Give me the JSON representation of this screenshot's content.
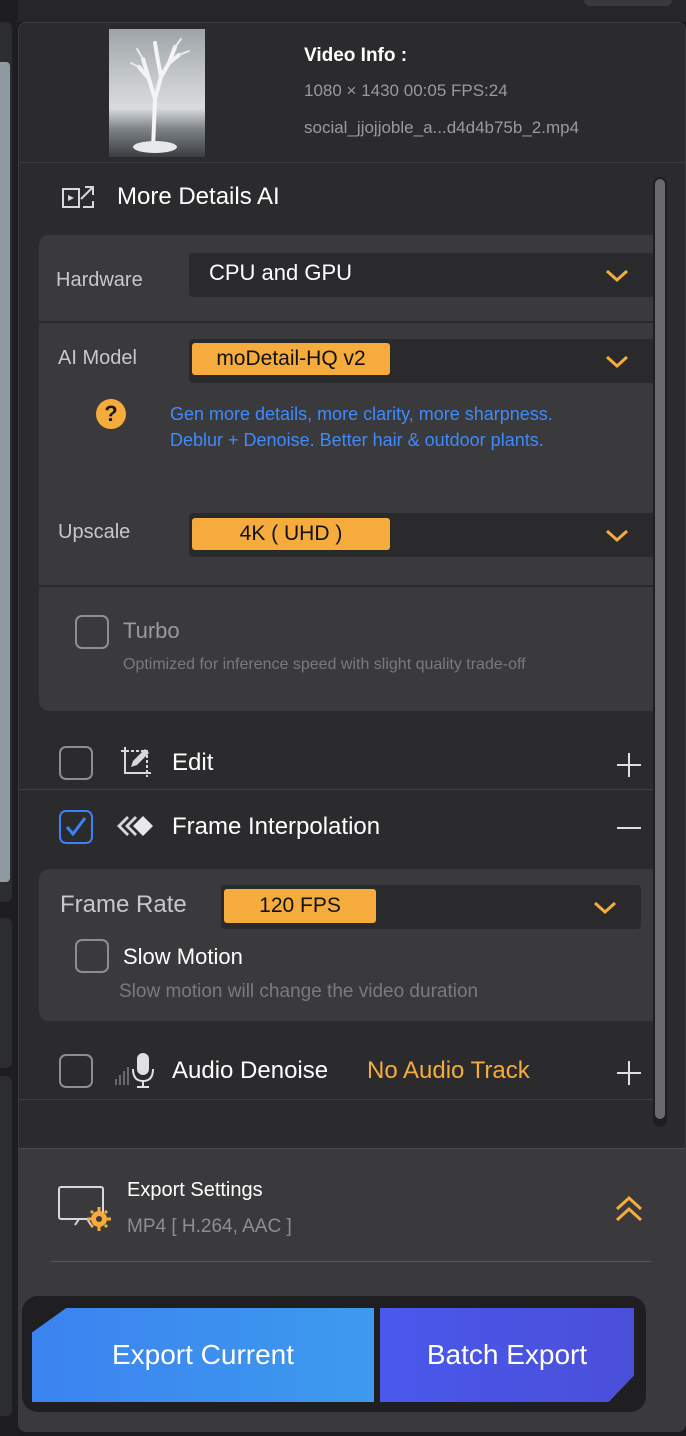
{
  "video_info": {
    "title": "Video Info :",
    "dims": "1080 × 1430 00:05 FPS:24",
    "filename": "social_jjojjoble_a...d4d4b75b_2.mp4"
  },
  "more_details": {
    "title": "More Details AI",
    "hardware_label": "Hardware",
    "hardware_value": "CPU and GPU",
    "model_label": "AI Model",
    "model_value": "moDetail-HQ  v2",
    "help_icon": "?",
    "help_text_1": "Gen more details, more clarity, more sharpness.",
    "help_text_2": "Deblur + Denoise. Better hair & outdoor plants.",
    "upscale_label": "Upscale",
    "upscale_value": "4K  ( UHD )",
    "turbo_label": "Turbo",
    "turbo_desc": "Optimized for inference speed with slight quality trade-off",
    "turbo_checked": false
  },
  "edit": {
    "label": "Edit",
    "checked": false
  },
  "frame_interpolation": {
    "label": "Frame Interpolation",
    "checked": true,
    "frame_rate_label": "Frame Rate",
    "frame_rate_value": "120 FPS",
    "slow_motion_label": "Slow Motion",
    "slow_motion_desc": "Slow motion will change the video duration",
    "slow_motion_checked": false
  },
  "audio_denoise": {
    "label": "Audio Denoise",
    "status": "No Audio Track",
    "checked": false
  },
  "export_settings": {
    "title": "Export Settings",
    "subtitle": "MP4 [ H.264, AAC ]"
  },
  "buttons": {
    "export_current": "Export Current",
    "batch_export": "Batch Export"
  },
  "colors": {
    "accent_orange": "#f5ac3c",
    "accent_blue": "#3b82f6",
    "batch_purple": "#4a52e2",
    "panel_bg": "#2b2b2d",
    "card_bg": "#3a3a3c"
  },
  "icons": [
    "more-details-icon",
    "chevron-down-icon",
    "help-icon",
    "edit-icon",
    "frame-interpolation-icon",
    "microphone-icon",
    "plus-icon",
    "minus-icon",
    "export-settings-icon",
    "double-chevron-up-icon",
    "checkmark-icon"
  ]
}
